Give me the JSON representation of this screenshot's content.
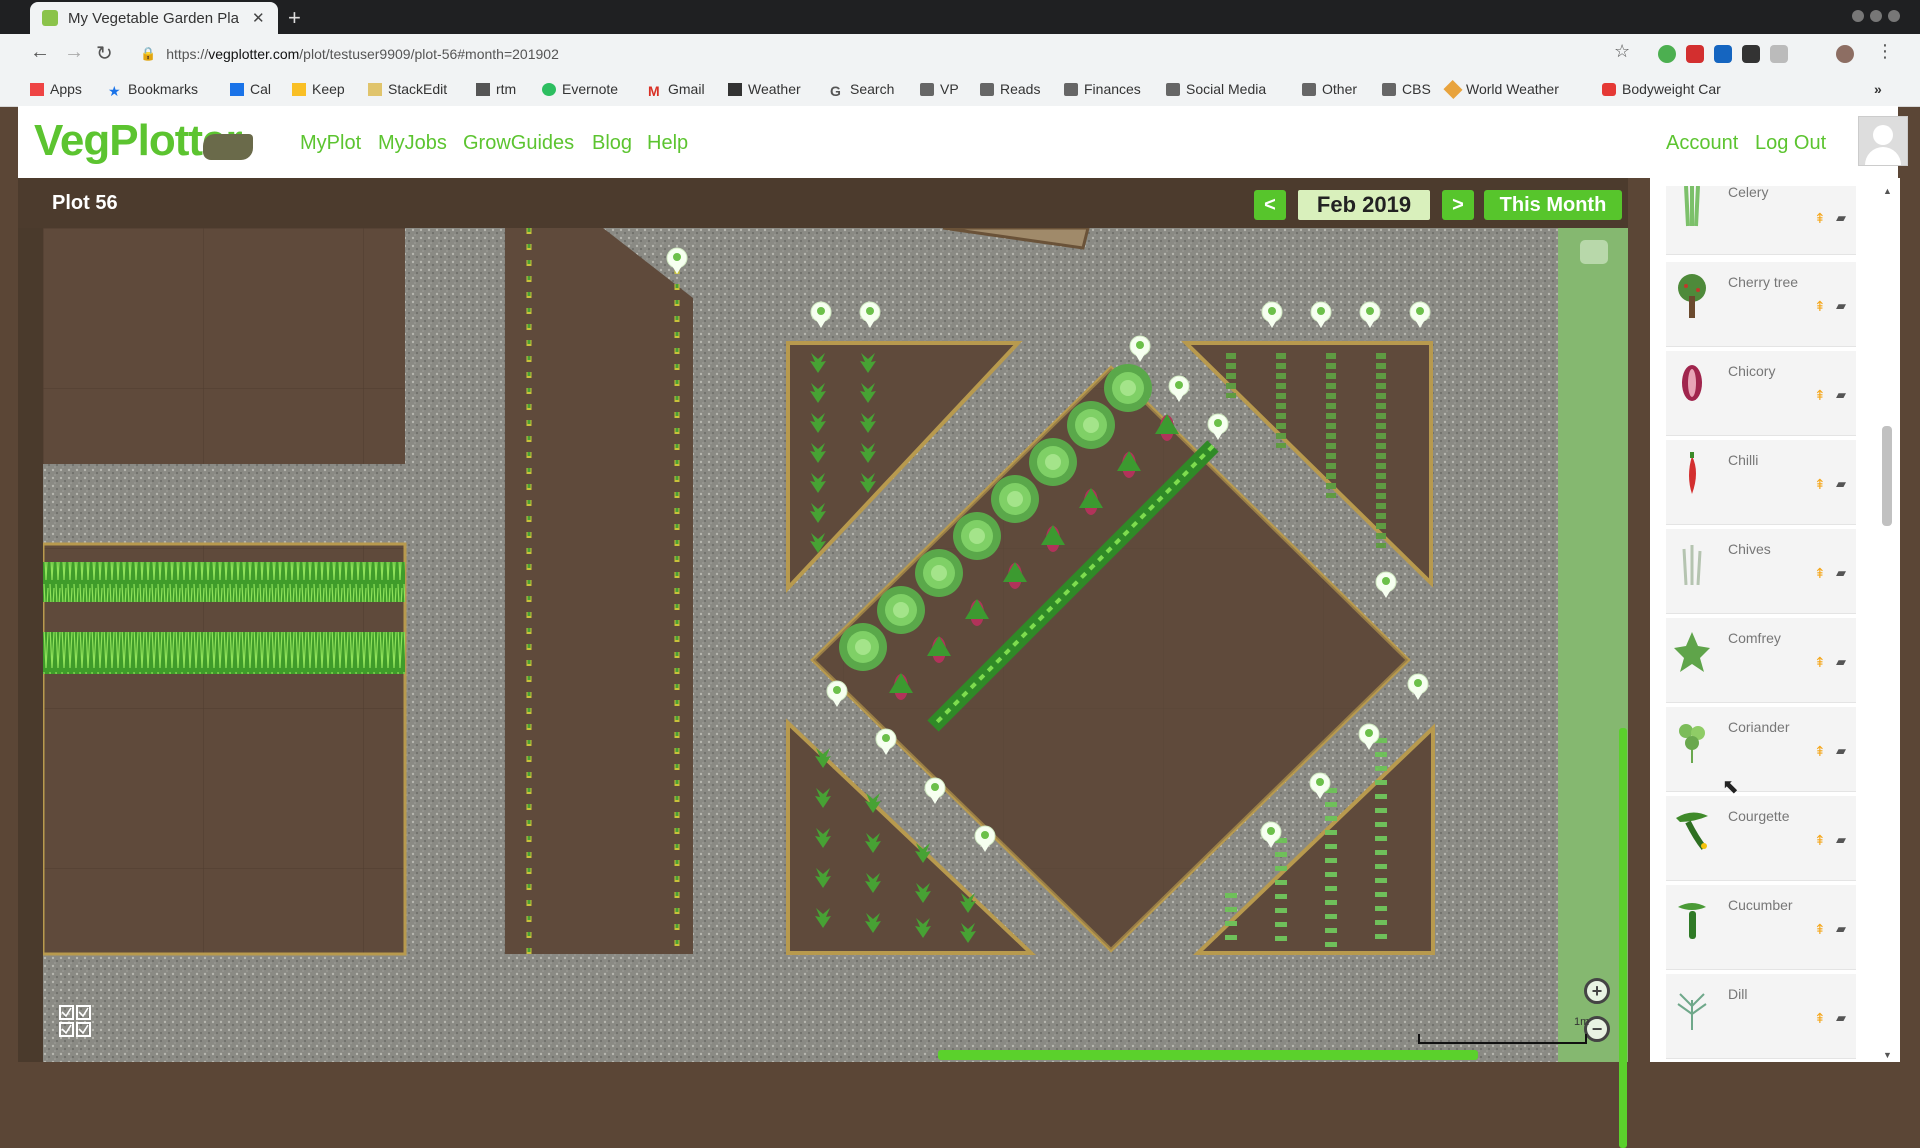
{
  "browser": {
    "tab_title": "My Vegetable Garden Pla",
    "url_prefix": "https://",
    "url_domain": "vegplotter.com",
    "url_path": "/plot/testuser9909/plot-56#month=201902",
    "bookmarks": [
      "Apps",
      "Bookmarks",
      "Cal",
      "Keep",
      "StackEdit",
      "rtm",
      "Evernote",
      "Gmail",
      "Weather",
      "Search",
      "VP",
      "Reads",
      "Finances",
      "Social Media",
      "Other",
      "CBS",
      "World Weather",
      "Bodyweight Car"
    ]
  },
  "site": {
    "logo": "VegPlotter",
    "nav": [
      "MyPlot",
      "MyJobs",
      "GrowGuides",
      "Blog",
      "Help"
    ],
    "account": "Account",
    "logout": "Log Out"
  },
  "plot": {
    "title": "Plot 56",
    "prev": "<",
    "next": ">",
    "month": "Feb 2019",
    "this_month": "This Month",
    "scale_label": "1m"
  },
  "sidebar": {
    "plants": [
      {
        "name": "Celery",
        "icon": "celery-icon"
      },
      {
        "name": "Cherry tree",
        "icon": "cherry-tree-icon"
      },
      {
        "name": "Chicory",
        "icon": "chicory-icon"
      },
      {
        "name": "Chilli",
        "icon": "chilli-icon"
      },
      {
        "name": "Chives",
        "icon": "chives-icon"
      },
      {
        "name": "Comfrey",
        "icon": "comfrey-icon"
      },
      {
        "name": "Coriander",
        "icon": "coriander-icon"
      },
      {
        "name": "Courgette",
        "icon": "courgette-icon"
      },
      {
        "name": "Cucumber",
        "icon": "cucumber-icon"
      },
      {
        "name": "Dill",
        "icon": "dill-icon"
      }
    ]
  },
  "colors": {
    "accent": "#5cc430",
    "path": "#8b8b86",
    "soil": "#5c4638",
    "bed_border": "#b89a4e"
  }
}
